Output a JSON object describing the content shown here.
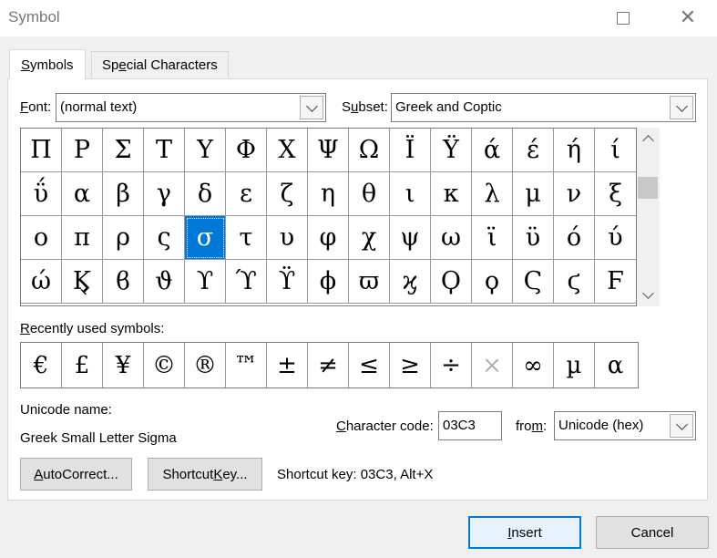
{
  "window": {
    "title": "Symbol"
  },
  "tabs": [
    {
      "label_pre": "",
      "label_ul": "S",
      "label_post": "ymbols"
    },
    {
      "label_pre": "Sp",
      "label_ul": "e",
      "label_post": "cial Characters"
    }
  ],
  "font": {
    "label_pre": "",
    "label_ul": "F",
    "label_post": "ont:",
    "value": "(normal text)"
  },
  "subset": {
    "label_pre": "S",
    "label_ul": "u",
    "label_post": "bset:",
    "value": "Greek and Coptic"
  },
  "symbols": [
    "Π",
    "Ρ",
    "Σ",
    "Τ",
    "Υ",
    "Φ",
    "Χ",
    "Ψ",
    "Ω",
    "Ϊ",
    "Ϋ",
    "ά",
    "έ",
    "ή",
    "ί",
    "ΰ",
    "α",
    "β",
    "γ",
    "δ",
    "ε",
    "ζ",
    "η",
    "θ",
    "ι",
    "κ",
    "λ",
    "μ",
    "ν",
    "ξ",
    "ο",
    "π",
    "ρ",
    "ς",
    "σ",
    "τ",
    "υ",
    "φ",
    "χ",
    "ψ",
    "ω",
    "ϊ",
    "ϋ",
    "ό",
    "ύ",
    "ώ",
    "Ϗ",
    "ϐ",
    "ϑ",
    "ϒ",
    "ϓ",
    "ϔ",
    "ϕ",
    "ϖ",
    "ϗ",
    "Ϙ",
    "ϙ",
    "Ϛ",
    "ϛ",
    "Ϝ"
  ],
  "selected_symbol": "σ",
  "recent": {
    "label_pre": "",
    "label_ul": "R",
    "label_post": "ecently used symbols:",
    "items": [
      "€",
      "£",
      "¥",
      "©",
      "®",
      "™",
      "±",
      "≠",
      "≤",
      "≥",
      "÷",
      "×",
      "∞",
      "µ",
      "α"
    ]
  },
  "unicode_name": {
    "label": "Unicode name:",
    "value": "Greek Small Letter Sigma"
  },
  "char_code": {
    "label_pre": "",
    "label_ul": "C",
    "label_post": "haracter code:",
    "value": "03C3"
  },
  "from": {
    "label_pre": "fro",
    "label_ul": "m",
    "label_post": ":",
    "value": "Unicode (hex)"
  },
  "buttons": {
    "autocorrect": {
      "pre": "",
      "ul": "A",
      "post": "utoCorrect..."
    },
    "shortcut_key": {
      "pre": "Shortcut ",
      "ul": "K",
      "post": "ey..."
    },
    "insert": {
      "pre": "",
      "ul": "I",
      "post": "nsert"
    },
    "cancel": "Cancel"
  },
  "shortcut_info": "Shortcut key: 03C3, Alt+X",
  "icons": {
    "maximize": "maximize-icon",
    "close": "close-icon",
    "dropdown": "chevron-down-icon"
  }
}
